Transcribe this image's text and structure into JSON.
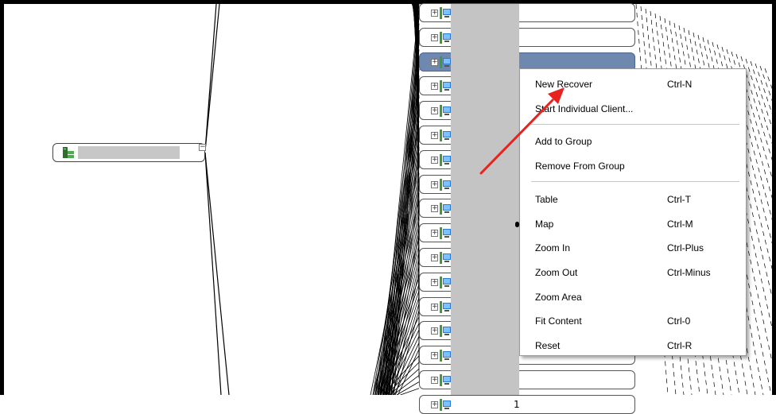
{
  "context_menu": {
    "items": [
      {
        "label": "New Recover",
        "shortcut": "Ctrl-N"
      },
      {
        "label": "Start Individual Client...",
        "shortcut": ""
      },
      {
        "label": "Add to Group",
        "shortcut": ""
      },
      {
        "label": "Remove From Group",
        "shortcut": ""
      },
      {
        "label": "Table",
        "shortcut": "Ctrl-T"
      },
      {
        "label": "Map",
        "shortcut": "Ctrl-M"
      },
      {
        "label": "Zoom In",
        "shortcut": "Ctrl-Plus"
      },
      {
        "label": "Zoom Out",
        "shortcut": "Ctrl-Minus"
      },
      {
        "label": "Zoom Area",
        "shortcut": ""
      },
      {
        "label": "Fit Content",
        "shortcut": "Ctrl-0"
      },
      {
        "label": "Reset",
        "shortcut": "Ctrl-R"
      }
    ],
    "checked_item": "Map"
  },
  "tree": {
    "client_nodes": [
      {
        "label": "",
        "selected": false
      },
      {
        "label": "",
        "selected": false
      },
      {
        "label": "",
        "selected": true
      },
      {
        "label": "",
        "selected": false
      },
      {
        "label": "",
        "selected": false
      },
      {
        "label": "",
        "selected": false
      },
      {
        "label": "",
        "selected": false
      },
      {
        "label": "",
        "selected": false
      },
      {
        "label": "",
        "selected": false
      },
      {
        "label": "",
        "selected": false
      },
      {
        "label": "",
        "selected": false
      },
      {
        "label": "",
        "selected": false
      },
      {
        "label": "",
        "selected": false
      },
      {
        "label": "",
        "selected": false
      },
      {
        "label": "",
        "selected": false
      },
      {
        "label": "",
        "selected": false
      },
      {
        "label": "1",
        "selected": false
      }
    ]
  },
  "colors": {
    "selection": "#6f88b0",
    "annotation_arrow": "#e8231f",
    "redaction": "#c4c4c4"
  }
}
